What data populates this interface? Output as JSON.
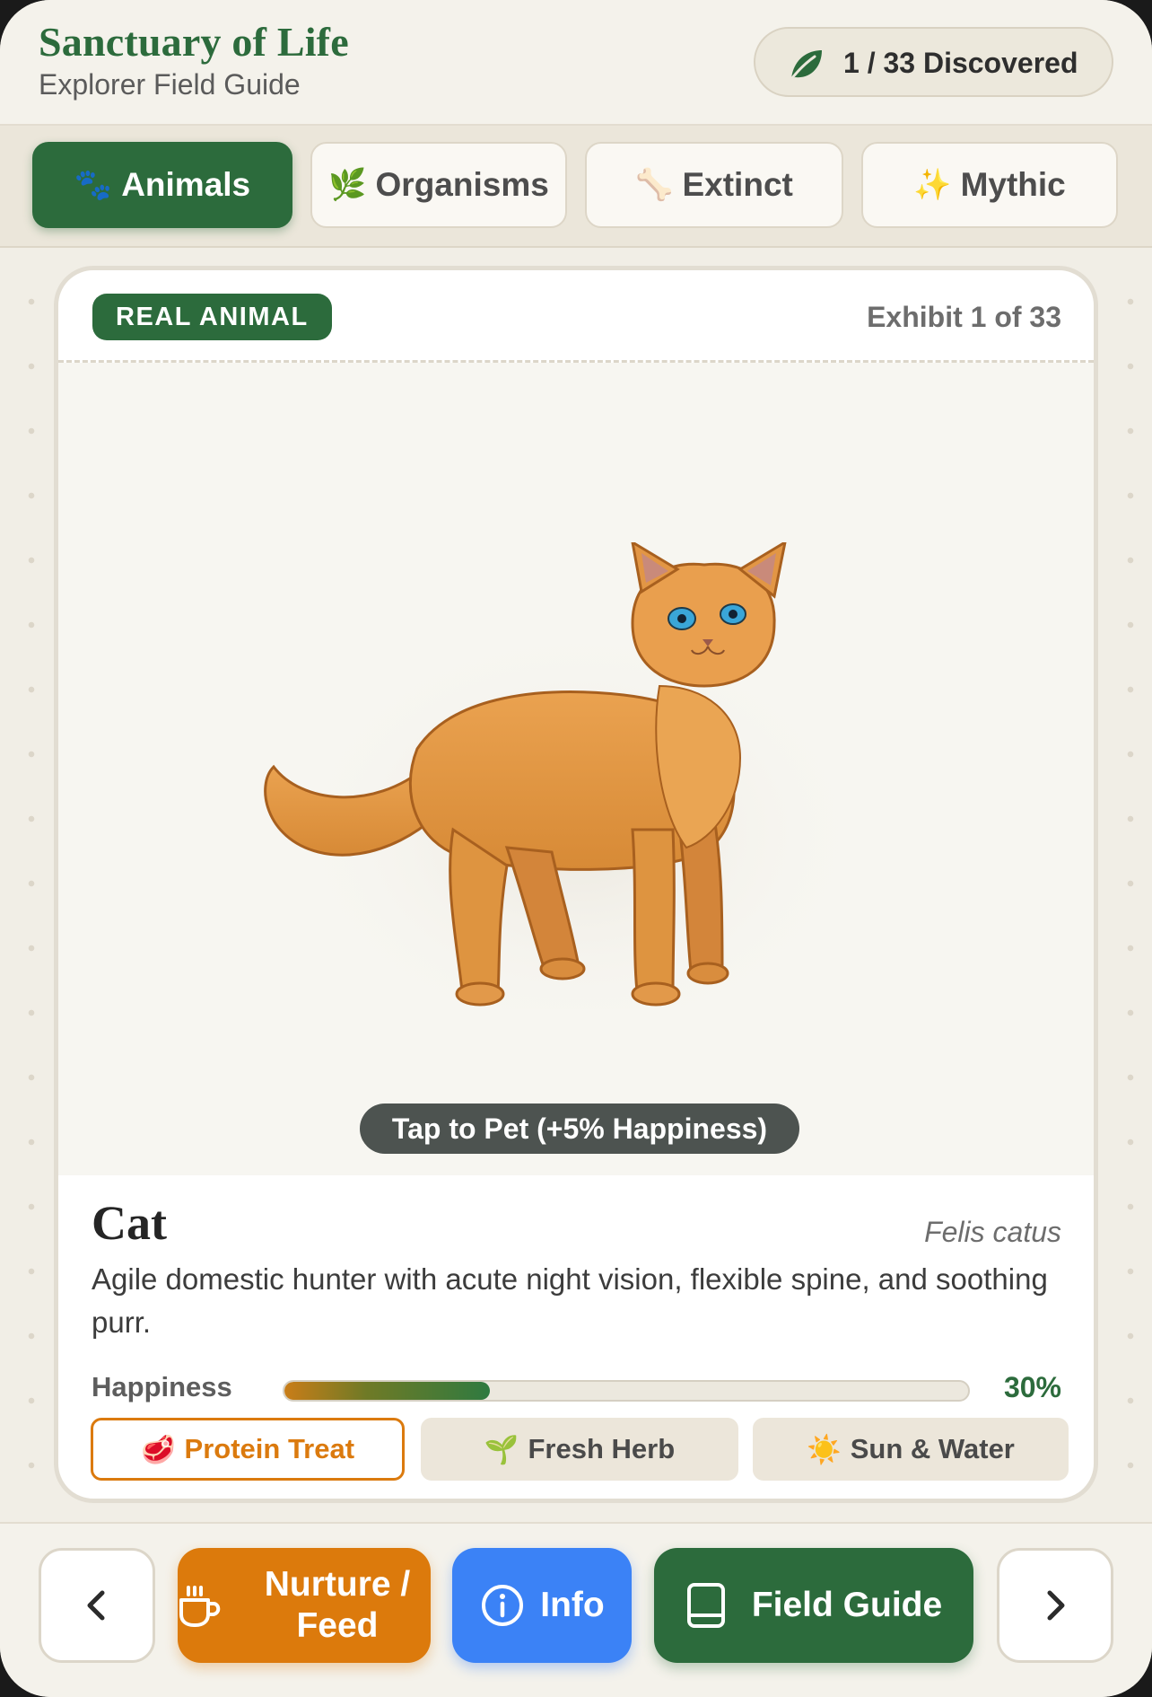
{
  "header": {
    "title": "Sanctuary of Life",
    "subtitle": "Explorer Field Guide",
    "discovered_label": "1 / 33 Discovered",
    "discovered_icon": "leaf-icon"
  },
  "tabs": [
    {
      "icon": "🐾",
      "label": "Animals",
      "active": true
    },
    {
      "icon": "🌿",
      "label": "Organisms",
      "active": false
    },
    {
      "icon": "🦴",
      "label": "Extinct",
      "active": false
    },
    {
      "icon": "✨",
      "label": "Mythic",
      "active": false
    }
  ],
  "card": {
    "badge": "REAL ANIMAL",
    "exhibit": "Exhibit 1 of 33",
    "pet_prompt": "Tap to Pet (+5% Happiness)",
    "name": "Cat",
    "scientific_name": "Felis catus",
    "description": "Agile domestic hunter with acute night vision, flexible spine, and soothing purr.",
    "happiness_label": "Happiness",
    "happiness_value": "30%",
    "happiness_fraction": 0.3,
    "foods": [
      {
        "icon": "🥩",
        "label": "Protein Treat",
        "selected": true
      },
      {
        "icon": "🌱",
        "label": "Fresh Herb",
        "selected": false
      },
      {
        "icon": "☀️",
        "label": "Sun & Water",
        "selected": false
      }
    ]
  },
  "bottom_bar": {
    "prev_icon": "chevron-left-icon",
    "nurture_label": "Nurture / Feed",
    "nurture_icon": "cup-icon",
    "info_label": "Info",
    "info_icon": "info-icon",
    "guide_label": "Field Guide",
    "guide_icon": "book-icon",
    "next_icon": "chevron-right-icon"
  },
  "colors": {
    "primary_green": "#2c6b3c",
    "accent_orange": "#dc7a0c",
    "info_blue": "#3b82f6",
    "background": "#f1eee6"
  }
}
